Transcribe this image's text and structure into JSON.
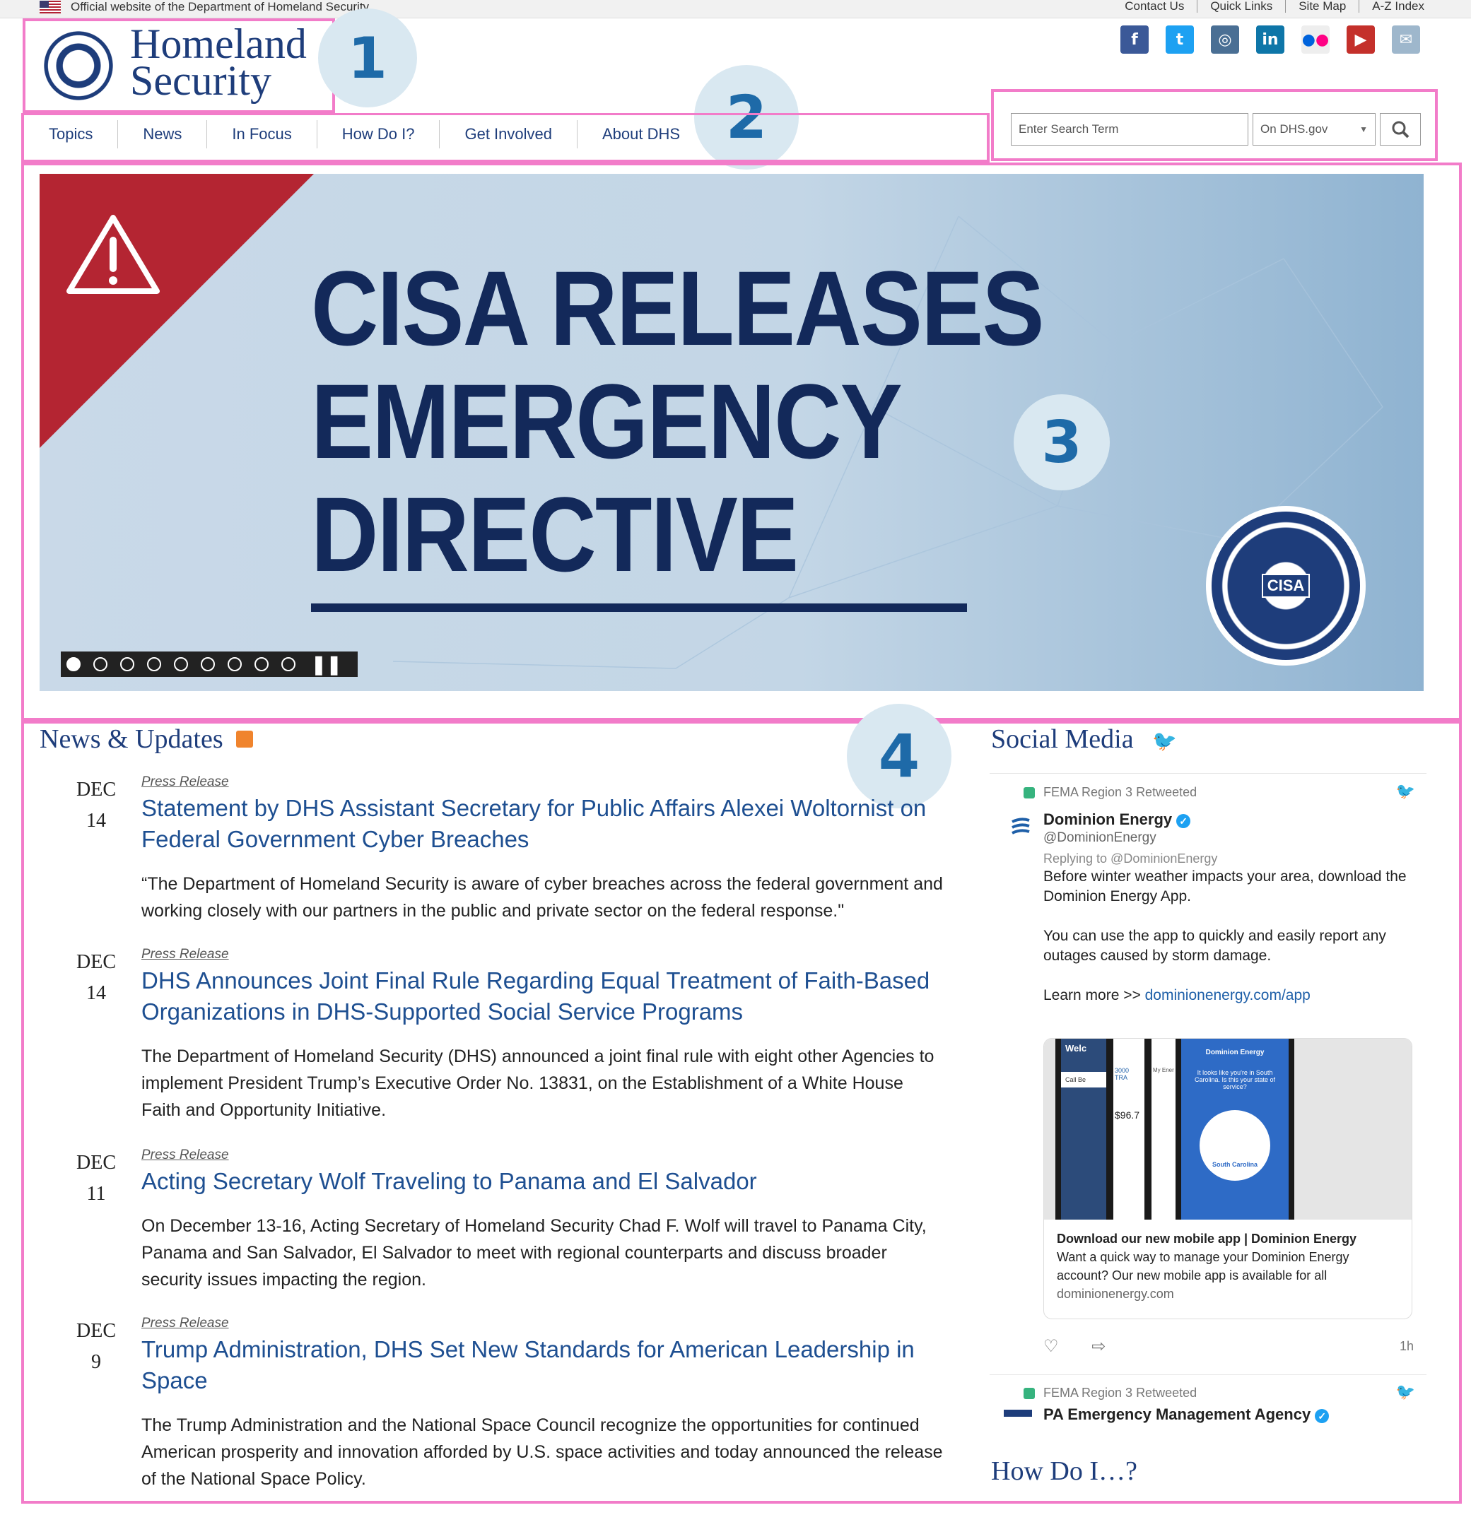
{
  "topbar": {
    "official": "Official website of the Department of Homeland Security",
    "links": [
      "Contact Us",
      "Quick Links",
      "Site Map",
      "A-Z Index"
    ]
  },
  "header": {
    "logo_line1": "Homeland",
    "logo_line2": "Security",
    "social_icons": [
      "facebook-icon",
      "twitter-icon",
      "instagram-icon",
      "linkedin-icon",
      "flickr-icon",
      "youtube-icon",
      "email-icon"
    ]
  },
  "badges": [
    "1",
    "2",
    "3",
    "4"
  ],
  "nav": {
    "items": [
      "Topics",
      "News",
      "In Focus",
      "How Do I?",
      "Get Involved",
      "About DHS"
    ]
  },
  "search": {
    "placeholder": "Enter Search Term",
    "scope": "On DHS.gov"
  },
  "hero": {
    "line1": "CISA RELEASES",
    "line2": "EMERGENCY",
    "line3": "DIRECTIVE",
    "seal_text": "CISA",
    "slides_total": 9,
    "active_slide": 1
  },
  "news": {
    "heading": "News & Updates",
    "items": [
      {
        "month": "DEC",
        "day": "14",
        "type": "Press Release",
        "title": "Statement by DHS Assistant Secretary for Public Affairs Alexei Woltornist on Federal Government Cyber Breaches",
        "desc": "“The Department of Homeland Security is aware of cyber breaches across the federal government and working closely with our partners in the public and private sector on the federal response.\""
      },
      {
        "month": "DEC",
        "day": "14",
        "type": "Press Release",
        "title": "DHS Announces Joint Final Rule Regarding Equal Treatment of Faith-Based Organizations in DHS-Supported Social Service Programs",
        "desc": "The Department of Homeland Security (DHS) announced a joint final rule with eight other Agencies to implement President Trump’s Executive Order No. 13831, on the Establishment of a White House Faith and Opportunity Initiative."
      },
      {
        "month": "DEC",
        "day": "11",
        "type": "Press Release",
        "title": "Acting Secretary Wolf Traveling to Panama and El Salvador",
        "desc": "On December 13-16, Acting Secretary of Homeland Security Chad F. Wolf will travel to Panama City, Panama and San Salvador, El Salvador to meet with regional counterparts and discuss broader security issues impacting the region."
      },
      {
        "month": "DEC",
        "day": "9",
        "type": "Press Release",
        "title": "Trump Administration, DHS Set New Standards for American Leadership in Space",
        "desc": "The Trump Administration and the National Space Council recognize the opportunities for continued American prosperity and innovation afforded by U.S. space activities and today announced the release of the National Space Policy."
      }
    ]
  },
  "social": {
    "heading": "Social Media",
    "tweet1": {
      "retweeted_by": "FEMA Region 3 Retweeted",
      "author": "Dominion Energy",
      "handle": "@DominionEnergy",
      "replying": "Replying to @DominionEnergy",
      "p1": "Before winter weather impacts your area, download the Dominion Energy App.",
      "p2": "You can use the app to quickly and easily report any outages caused by storm damage.",
      "p3_prefix": "Learn more >> ",
      "p3_link": "dominionenergy.com/app",
      "card_title": "Download our new mobile app | Dominion Energy",
      "card_desc": "Want a quick way to manage your Dominion Energy account? Our new mobile app is available for all",
      "card_url": "dominionenergy.com",
      "time": "1h",
      "card_img_texts": [
        "Welc",
        "Call Be",
        "3000 TRA",
        "$96.7",
        "My Ener",
        "Dominion Energy",
        "It looks like you're in South Carolina. Is this your state of service?",
        "South Carolina"
      ]
    },
    "tweet2": {
      "retweeted_by": "FEMA Region 3 Retweeted",
      "author": "PA Emergency Management Agency"
    }
  },
  "how_do_i": {
    "heading": "How Do I…?"
  }
}
